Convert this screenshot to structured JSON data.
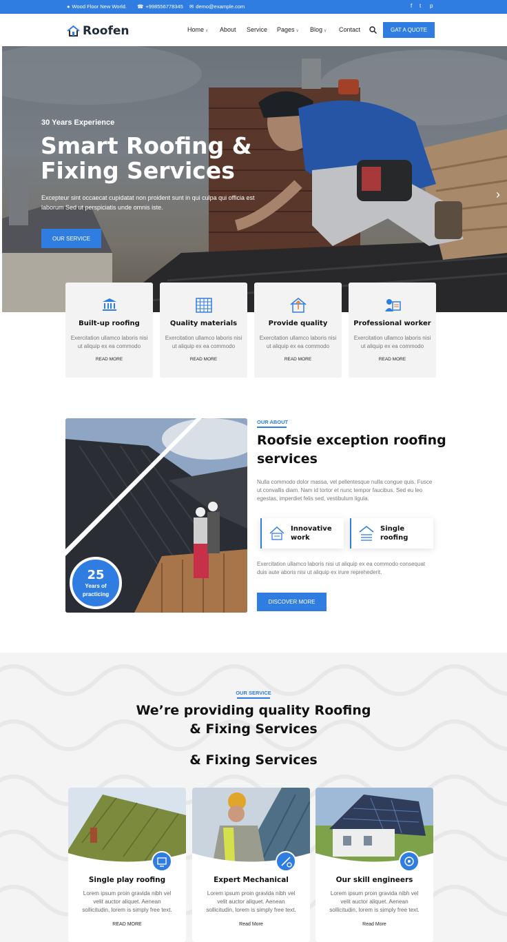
{
  "topbar": {
    "address": "Wood Floor New World.",
    "phone": "+998556778345",
    "email": "demo@example.com",
    "social": [
      "f",
      "t",
      "p"
    ]
  },
  "header": {
    "logo": "Roofen",
    "nav": [
      "Home",
      "About",
      "Service",
      "Pages",
      "Blog",
      "Contact"
    ],
    "quote_button": "GAT A QUOTE"
  },
  "hero": {
    "kicker": "30 Years Experience",
    "title_line1": "Smart Roofing &",
    "title_line2": "Fixing Services",
    "text_line1": "Excepteur sint occaecat cupidatat non proident sunt in qui culpa qui officia est",
    "text_line2": "laborum Sed ut perspiciatis unde omnis iste.",
    "button": "OUR SERVICE",
    "next_arrow": "›"
  },
  "features": [
    {
      "title": "Built-up roofing",
      "desc_line1": "Exercitation ullamco laboris nisi",
      "desc_line2": "ut aliquip ex ea commodo",
      "link": "READ MORE",
      "icon": "bank-icon"
    },
    {
      "title": "Quality materials",
      "desc_line1": "Exercitation ullamco laboris nisi",
      "desc_line2": "ut aliquip ex ea commodo",
      "link": "READ MORE",
      "icon": "grid-icon"
    },
    {
      "title": "Provide quality",
      "desc_line1": "Exercitation ullamco laboris nisi",
      "desc_line2": "ut aliquip ex ea commodo",
      "link": "READ MORE",
      "icon": "house-icon"
    },
    {
      "title": "Professional worker",
      "desc_line1": "Exercitation ullamco laboris nisi",
      "desc_line2": "ut aliquip ex ea commodo",
      "link": "READ MORE",
      "icon": "worker-icon"
    }
  ],
  "about": {
    "kicker": "OUR ABOUT",
    "title_line1": "Roofsie exception roofing",
    "title_line2": "services",
    "para_line1": "Nulla commodo dolor massa, vel pellentesque nulla congue quis. Fusce",
    "para_line2": "ut convallis diam. Nam id tortor et nunc tempor faucibus. Sed eu leo",
    "para_line3": "egestas, imperdiet felis sed, vestibulum ligula.",
    "badge_number": "25",
    "badge_line1": "Years of",
    "badge_line2": "practicing",
    "feature1_line1": "Innovative",
    "feature1_line2": "work",
    "feature2_line1": "Single",
    "feature2_line2": "roofing",
    "para2_line1": "Exercitation ullamco laboris nisi ut aliquip ex ea commodo consequat",
    "para2_line2": "duis aute aboris nisi ut aliquip ex irure reprehederit.",
    "button": "DISCOVER MORE"
  },
  "services": {
    "kicker": "OUR SERVICE",
    "title_line1": "We’re providing quality Roofing",
    "title_line2": "& Fixing Services",
    "title_line3": "& Fixing Services",
    "cards": [
      {
        "title": "Single play roofing",
        "d1": "Lorem ipsum proin gravida nibh vel",
        "d2": "velit auctor aliquet. Aenean",
        "d3": "sollicitudin, lorem is simply free text.",
        "link": "READ MORE"
      },
      {
        "title": "Expert Mechanical",
        "d1": "Lorem ipsum proin gravida nibh vel",
        "d2": "velit auctor aliquet. Aenean",
        "d3": "sollicitudin, lorem is simply free text.",
        "link": "Read More"
      },
      {
        "title": "Our skill engineers",
        "d1": "Lorem ipsum proin gravida nibh vel",
        "d2": "velit auctor aliquet. Aenean",
        "d3": "sollicitudin, lorem is simply free text.",
        "link": "Read More"
      }
    ]
  },
  "colors": {
    "accent": "#2f7de1",
    "dark": "#111111",
    "muted": "#777777"
  }
}
